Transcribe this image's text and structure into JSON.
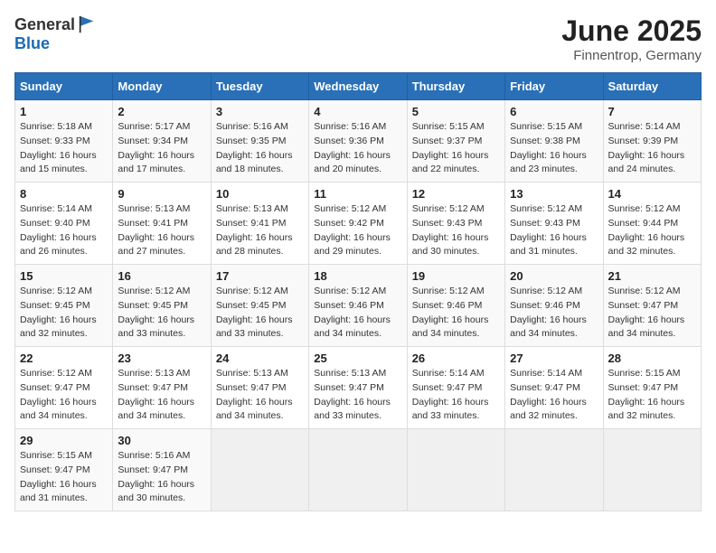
{
  "header": {
    "logo_general": "General",
    "logo_blue": "Blue",
    "title": "June 2025",
    "subtitle": "Finnentrop, Germany"
  },
  "calendar": {
    "days_of_week": [
      "Sunday",
      "Monday",
      "Tuesday",
      "Wednesday",
      "Thursday",
      "Friday",
      "Saturday"
    ],
    "weeks": [
      [
        null,
        {
          "day": "2",
          "sunrise": "Sunrise: 5:17 AM",
          "sunset": "Sunset: 9:34 PM",
          "daylight": "Daylight: 16 hours and 17 minutes."
        },
        {
          "day": "3",
          "sunrise": "Sunrise: 5:16 AM",
          "sunset": "Sunset: 9:35 PM",
          "daylight": "Daylight: 16 hours and 18 minutes."
        },
        {
          "day": "4",
          "sunrise": "Sunrise: 5:16 AM",
          "sunset": "Sunset: 9:36 PM",
          "daylight": "Daylight: 16 hours and 20 minutes."
        },
        {
          "day": "5",
          "sunrise": "Sunrise: 5:15 AM",
          "sunset": "Sunset: 9:37 PM",
          "daylight": "Daylight: 16 hours and 22 minutes."
        },
        {
          "day": "6",
          "sunrise": "Sunrise: 5:15 AM",
          "sunset": "Sunset: 9:38 PM",
          "daylight": "Daylight: 16 hours and 23 minutes."
        },
        {
          "day": "7",
          "sunrise": "Sunrise: 5:14 AM",
          "sunset": "Sunset: 9:39 PM",
          "daylight": "Daylight: 16 hours and 24 minutes."
        }
      ],
      [
        {
          "day": "1",
          "sunrise": "Sunrise: 5:18 AM",
          "sunset": "Sunset: 9:33 PM",
          "daylight": "Daylight: 16 hours and 15 minutes."
        },
        {
          "day": "9",
          "sunrise": "Sunrise: 5:13 AM",
          "sunset": "Sunset: 9:41 PM",
          "daylight": "Daylight: 16 hours and 27 minutes."
        },
        {
          "day": "10",
          "sunrise": "Sunrise: 5:13 AM",
          "sunset": "Sunset: 9:41 PM",
          "daylight": "Daylight: 16 hours and 28 minutes."
        },
        {
          "day": "11",
          "sunrise": "Sunrise: 5:12 AM",
          "sunset": "Sunset: 9:42 PM",
          "daylight": "Daylight: 16 hours and 29 minutes."
        },
        {
          "day": "12",
          "sunrise": "Sunrise: 5:12 AM",
          "sunset": "Sunset: 9:43 PM",
          "daylight": "Daylight: 16 hours and 30 minutes."
        },
        {
          "day": "13",
          "sunrise": "Sunrise: 5:12 AM",
          "sunset": "Sunset: 9:43 PM",
          "daylight": "Daylight: 16 hours and 31 minutes."
        },
        {
          "day": "14",
          "sunrise": "Sunrise: 5:12 AM",
          "sunset": "Sunset: 9:44 PM",
          "daylight": "Daylight: 16 hours and 32 minutes."
        }
      ],
      [
        {
          "day": "8",
          "sunrise": "Sunrise: 5:14 AM",
          "sunset": "Sunset: 9:40 PM",
          "daylight": "Daylight: 16 hours and 26 minutes."
        },
        {
          "day": "16",
          "sunrise": "Sunrise: 5:12 AM",
          "sunset": "Sunset: 9:45 PM",
          "daylight": "Daylight: 16 hours and 33 minutes."
        },
        {
          "day": "17",
          "sunrise": "Sunrise: 5:12 AM",
          "sunset": "Sunset: 9:45 PM",
          "daylight": "Daylight: 16 hours and 33 minutes."
        },
        {
          "day": "18",
          "sunrise": "Sunrise: 5:12 AM",
          "sunset": "Sunset: 9:46 PM",
          "daylight": "Daylight: 16 hours and 34 minutes."
        },
        {
          "day": "19",
          "sunrise": "Sunrise: 5:12 AM",
          "sunset": "Sunset: 9:46 PM",
          "daylight": "Daylight: 16 hours and 34 minutes."
        },
        {
          "day": "20",
          "sunrise": "Sunrise: 5:12 AM",
          "sunset": "Sunset: 9:46 PM",
          "daylight": "Daylight: 16 hours and 34 minutes."
        },
        {
          "day": "21",
          "sunrise": "Sunrise: 5:12 AM",
          "sunset": "Sunset: 9:47 PM",
          "daylight": "Daylight: 16 hours and 34 minutes."
        }
      ],
      [
        {
          "day": "15",
          "sunrise": "Sunrise: 5:12 AM",
          "sunset": "Sunset: 9:45 PM",
          "daylight": "Daylight: 16 hours and 32 minutes."
        },
        {
          "day": "23",
          "sunrise": "Sunrise: 5:13 AM",
          "sunset": "Sunset: 9:47 PM",
          "daylight": "Daylight: 16 hours and 34 minutes."
        },
        {
          "day": "24",
          "sunrise": "Sunrise: 5:13 AM",
          "sunset": "Sunset: 9:47 PM",
          "daylight": "Daylight: 16 hours and 34 minutes."
        },
        {
          "day": "25",
          "sunrise": "Sunrise: 5:13 AM",
          "sunset": "Sunset: 9:47 PM",
          "daylight": "Daylight: 16 hours and 33 minutes."
        },
        {
          "day": "26",
          "sunrise": "Sunrise: 5:14 AM",
          "sunset": "Sunset: 9:47 PM",
          "daylight": "Daylight: 16 hours and 33 minutes."
        },
        {
          "day": "27",
          "sunrise": "Sunrise: 5:14 AM",
          "sunset": "Sunset: 9:47 PM",
          "daylight": "Daylight: 16 hours and 32 minutes."
        },
        {
          "day": "28",
          "sunrise": "Sunrise: 5:15 AM",
          "sunset": "Sunset: 9:47 PM",
          "daylight": "Daylight: 16 hours and 32 minutes."
        }
      ],
      [
        {
          "day": "22",
          "sunrise": "Sunrise: 5:12 AM",
          "sunset": "Sunset: 9:47 PM",
          "daylight": "Daylight: 16 hours and 34 minutes."
        },
        {
          "day": "30",
          "sunrise": "Sunrise: 5:16 AM",
          "sunset": "Sunset: 9:47 PM",
          "daylight": "Daylight: 16 hours and 30 minutes."
        },
        null,
        null,
        null,
        null,
        null
      ],
      [
        {
          "day": "29",
          "sunrise": "Sunrise: 5:15 AM",
          "sunset": "Sunset: 9:47 PM",
          "daylight": "Daylight: 16 hours and 31 minutes."
        },
        null,
        null,
        null,
        null,
        null,
        null
      ]
    ]
  }
}
